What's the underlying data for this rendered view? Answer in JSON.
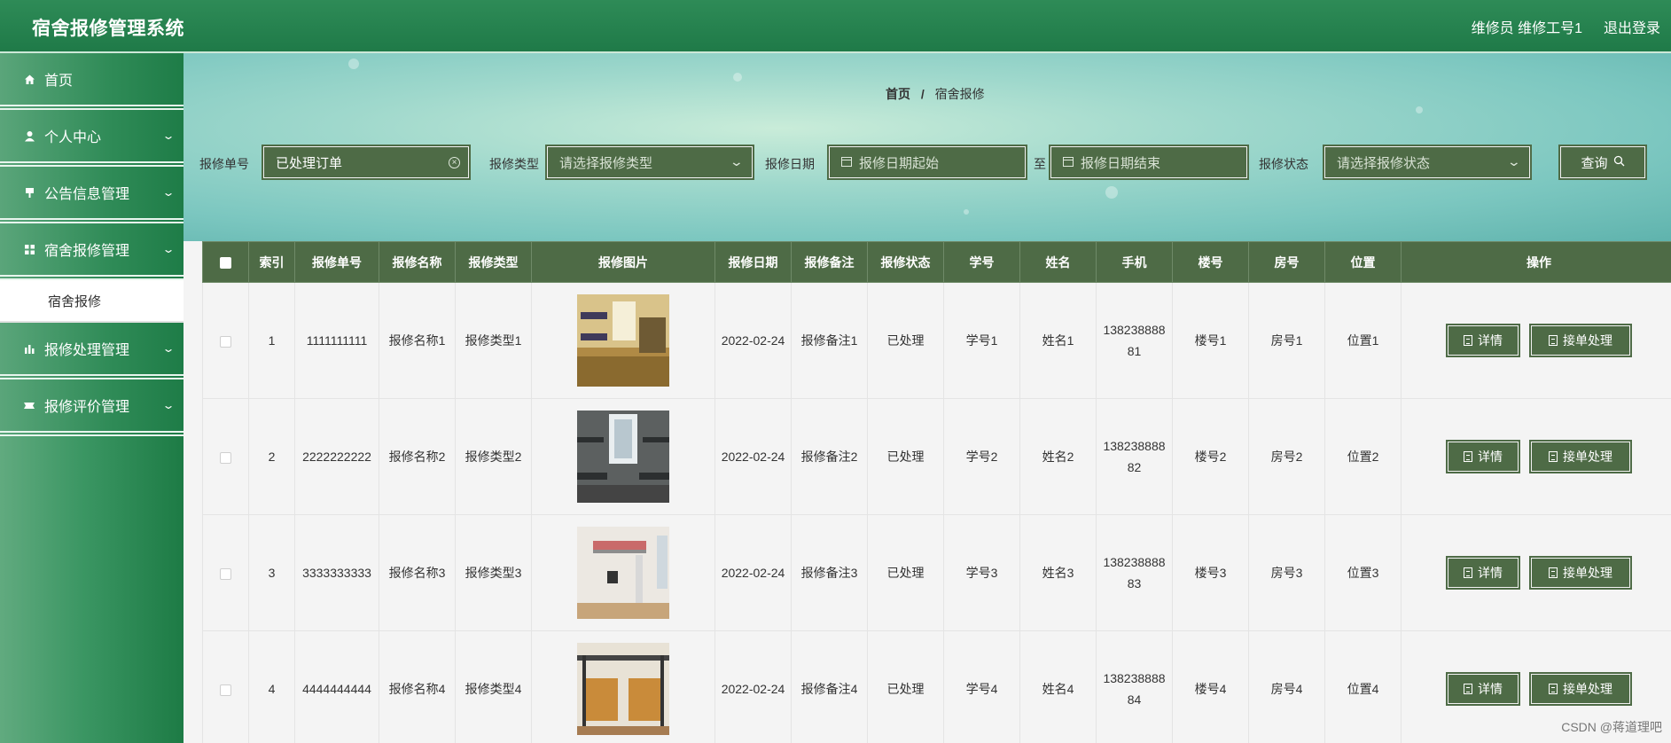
{
  "app": {
    "title": "宿舍报修管理系统"
  },
  "header": {
    "user_label": "维修员 维修工号1",
    "logout_label": "退出登录"
  },
  "sidebar": {
    "items": [
      {
        "label": "首页",
        "icon": "home-icon",
        "expandable": false
      },
      {
        "label": "个人中心",
        "icon": "user-icon",
        "expandable": true
      },
      {
        "label": "公告信息管理",
        "icon": "notice-icon",
        "expandable": true
      },
      {
        "label": "宿舍报修管理",
        "icon": "grid-icon",
        "expandable": true,
        "children": [
          {
            "label": "宿舍报修"
          }
        ]
      },
      {
        "label": "报修处理管理",
        "icon": "chart-icon",
        "expandable": true
      },
      {
        "label": "报修评价管理",
        "icon": "ticket-icon",
        "expandable": true
      }
    ]
  },
  "breadcrumb": {
    "home": "首页",
    "separator": "/",
    "current": "宿舍报修"
  },
  "search": {
    "order_no_label": "报修单号",
    "order_no_value": "已处理订单",
    "type_label": "报修类型",
    "type_placeholder": "请选择报修类型",
    "date_label": "报修日期",
    "date_start_placeholder": "报修日期起始",
    "date_sep": "至",
    "date_end_placeholder": "报修日期结束",
    "status_label": "报修状态",
    "status_placeholder": "请选择报修状态",
    "query_label": "查询"
  },
  "table": {
    "columns": [
      "索引",
      "报修单号",
      "报修名称",
      "报修类型",
      "报修图片",
      "报修日期",
      "报修备注",
      "报修状态",
      "学号",
      "姓名",
      "手机",
      "楼号",
      "房号",
      "位置",
      "操作"
    ],
    "detail_label": "详情",
    "handle_label": "接单处理",
    "rows": [
      {
        "index": "1",
        "order_no": "1111111111",
        "name": "报修名称1",
        "type": "报修类型1",
        "image_style": "dorm-yellow",
        "date": "2022-02-24",
        "note": "报修备注1",
        "status": "已处理",
        "student_no": "学号1",
        "student_name": "姓名1",
        "phone": "13823888881",
        "building": "楼号1",
        "room": "房号1",
        "location": "位置1"
      },
      {
        "index": "2",
        "order_no": "2222222222",
        "name": "报修名称2",
        "type": "报修类型2",
        "image_style": "dorm-gray",
        "date": "2022-02-24",
        "note": "报修备注2",
        "status": "已处理",
        "student_no": "学号2",
        "student_name": "姓名2",
        "phone": "13823888882",
        "building": "楼号2",
        "room": "房号2",
        "location": "位置2"
      },
      {
        "index": "3",
        "order_no": "3333333333",
        "name": "报修名称3",
        "type": "报修类型3",
        "image_style": "dorm-white",
        "date": "2022-02-24",
        "note": "报修备注3",
        "status": "已处理",
        "student_no": "学号3",
        "student_name": "姓名3",
        "phone": "13823888883",
        "building": "楼号3",
        "room": "房号3",
        "location": "位置3"
      },
      {
        "index": "4",
        "order_no": "4444444444",
        "name": "报修名称4",
        "type": "报修类型4",
        "image_style": "dorm-wood",
        "date": "2022-02-24",
        "note": "报修备注4",
        "status": "已处理",
        "student_no": "学号4",
        "student_name": "姓名4",
        "phone": "13823888884",
        "building": "楼号4",
        "room": "房号4",
        "location": "位置4"
      }
    ]
  },
  "watermark": "CSDN @蒋道理吧",
  "colors": {
    "header_green": "#2e8b57",
    "control_green": "#4e6b46",
    "background": "#f4f4f4"
  }
}
